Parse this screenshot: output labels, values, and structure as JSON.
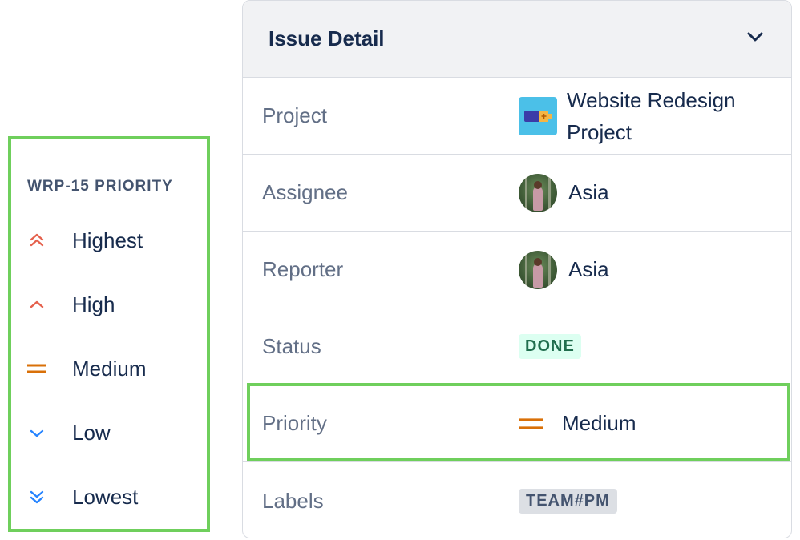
{
  "legend": {
    "title": "WRP-15 PRIORITY",
    "items": [
      {
        "label": "Highest",
        "icon": "priority-highest-icon",
        "color": "#e5604c"
      },
      {
        "label": "High",
        "icon": "priority-high-icon",
        "color": "#e5604c"
      },
      {
        "label": "Medium",
        "icon": "priority-medium-icon",
        "color": "#d97008"
      },
      {
        "label": "Low",
        "icon": "priority-low-icon",
        "color": "#2684ff"
      },
      {
        "label": "Lowest",
        "icon": "priority-lowest-icon",
        "color": "#2684ff"
      }
    ]
  },
  "panel": {
    "title": "Issue Detail",
    "collapse_icon": "chevron-down-icon",
    "fields": {
      "project": {
        "label": "Project",
        "value_line1": "Website Redesign",
        "value_line2": "Project"
      },
      "assignee": {
        "label": "Assignee",
        "value": "Asia"
      },
      "reporter": {
        "label": "Reporter",
        "value": "Asia"
      },
      "status": {
        "label": "Status",
        "value": "DONE"
      },
      "priority": {
        "label": "Priority",
        "value": "Medium"
      },
      "labels": {
        "label": "Labels",
        "value": "TEAM#PM"
      }
    }
  },
  "colors": {
    "highlight": "#6fcf5c",
    "status_done_bg": "#dcfff1",
    "status_done_text": "#216e4e"
  }
}
